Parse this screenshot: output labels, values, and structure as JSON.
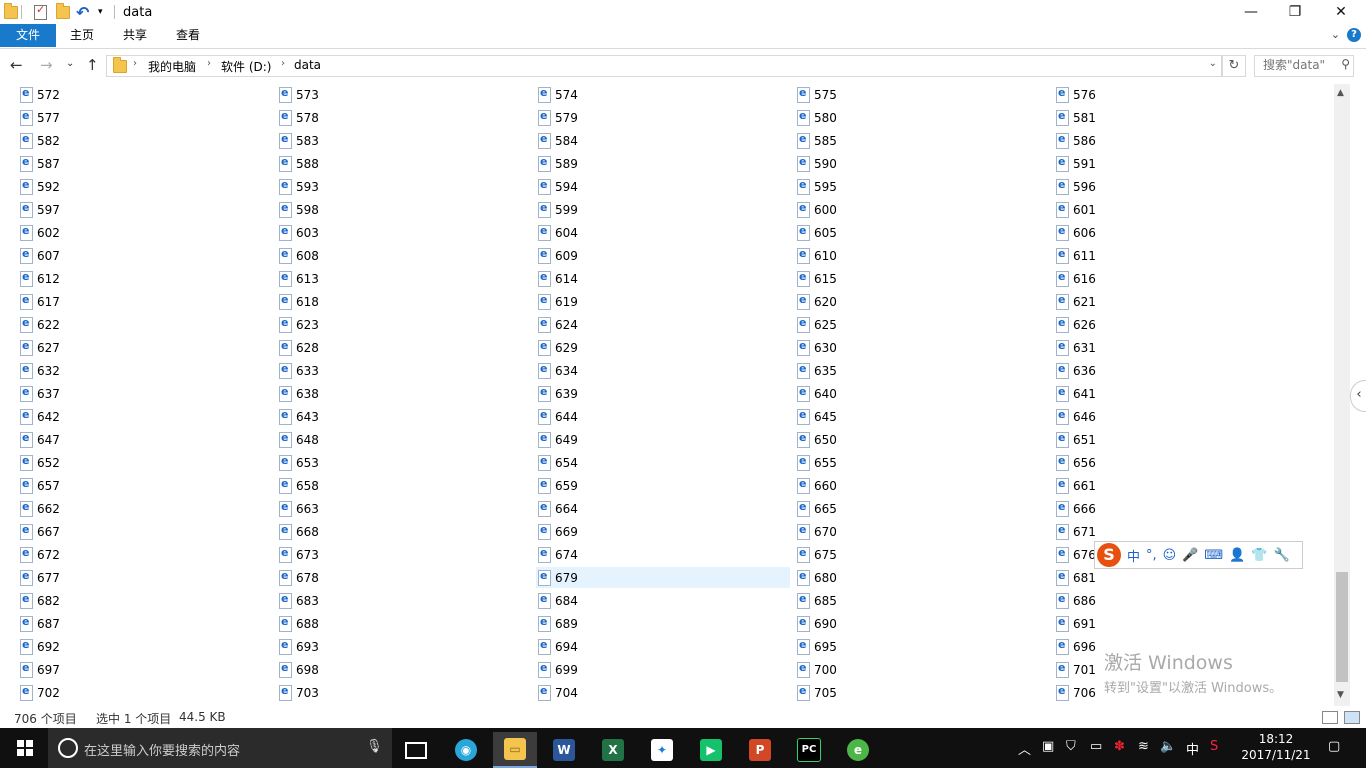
{
  "window": {
    "title": "data",
    "controls": [
      "—",
      "❐",
      "✕"
    ]
  },
  "ribbon": {
    "tabs": [
      "文件",
      "主页",
      "共享",
      "查看"
    ]
  },
  "address": {
    "crumbs": [
      "我的电脑",
      "软件 (D:)",
      "data"
    ],
    "search_placeholder": "搜索\"data\""
  },
  "files": {
    "start": 572,
    "end": 706,
    "columns": 5,
    "selected": "679",
    "items": [
      "572",
      "573",
      "574",
      "575",
      "576",
      "577",
      "578",
      "579",
      "580",
      "581",
      "582",
      "583",
      "584",
      "585",
      "586",
      "587",
      "588",
      "589",
      "590",
      "591",
      "592",
      "593",
      "594",
      "595",
      "596",
      "597",
      "598",
      "599",
      "600",
      "601",
      "602",
      "603",
      "604",
      "605",
      "606",
      "607",
      "608",
      "609",
      "610",
      "611",
      "612",
      "613",
      "614",
      "615",
      "616",
      "617",
      "618",
      "619",
      "620",
      "621",
      "622",
      "623",
      "624",
      "625",
      "626",
      "627",
      "628",
      "629",
      "630",
      "631",
      "632",
      "633",
      "634",
      "635",
      "636",
      "637",
      "638",
      "639",
      "640",
      "641",
      "642",
      "643",
      "644",
      "645",
      "646",
      "647",
      "648",
      "649",
      "650",
      "651",
      "652",
      "653",
      "654",
      "655",
      "656",
      "657",
      "658",
      "659",
      "660",
      "661",
      "662",
      "663",
      "664",
      "665",
      "666",
      "667",
      "668",
      "669",
      "670",
      "671",
      "672",
      "673",
      "674",
      "675",
      "676",
      "677",
      "678",
      "679",
      "680",
      "681",
      "682",
      "683",
      "684",
      "685",
      "686",
      "687",
      "688",
      "689",
      "690",
      "691",
      "692",
      "693",
      "694",
      "695",
      "696",
      "697",
      "698",
      "699",
      "700",
      "701",
      "702",
      "703",
      "704",
      "705",
      "706"
    ]
  },
  "status": {
    "count": "706 个项目",
    "selection": "选中 1 个项目",
    "size": "44.5 KB"
  },
  "ime": {
    "items": [
      "中",
      "°,",
      "☺",
      "🎤",
      "⌨",
      "👤",
      "👕",
      "🔧"
    ]
  },
  "watermark": {
    "line1": "激活 Windows",
    "line2": "转到\"设置\"以激活 Windows。"
  },
  "taskbar": {
    "search_placeholder": "在这里输入你要搜索的内容",
    "ime_lang": "中",
    "time": "18:12",
    "date": "2017/11/21"
  },
  "colors": {
    "accent": "#1979ca",
    "selection": "#e5f3ff",
    "taskbar": "#101010"
  }
}
